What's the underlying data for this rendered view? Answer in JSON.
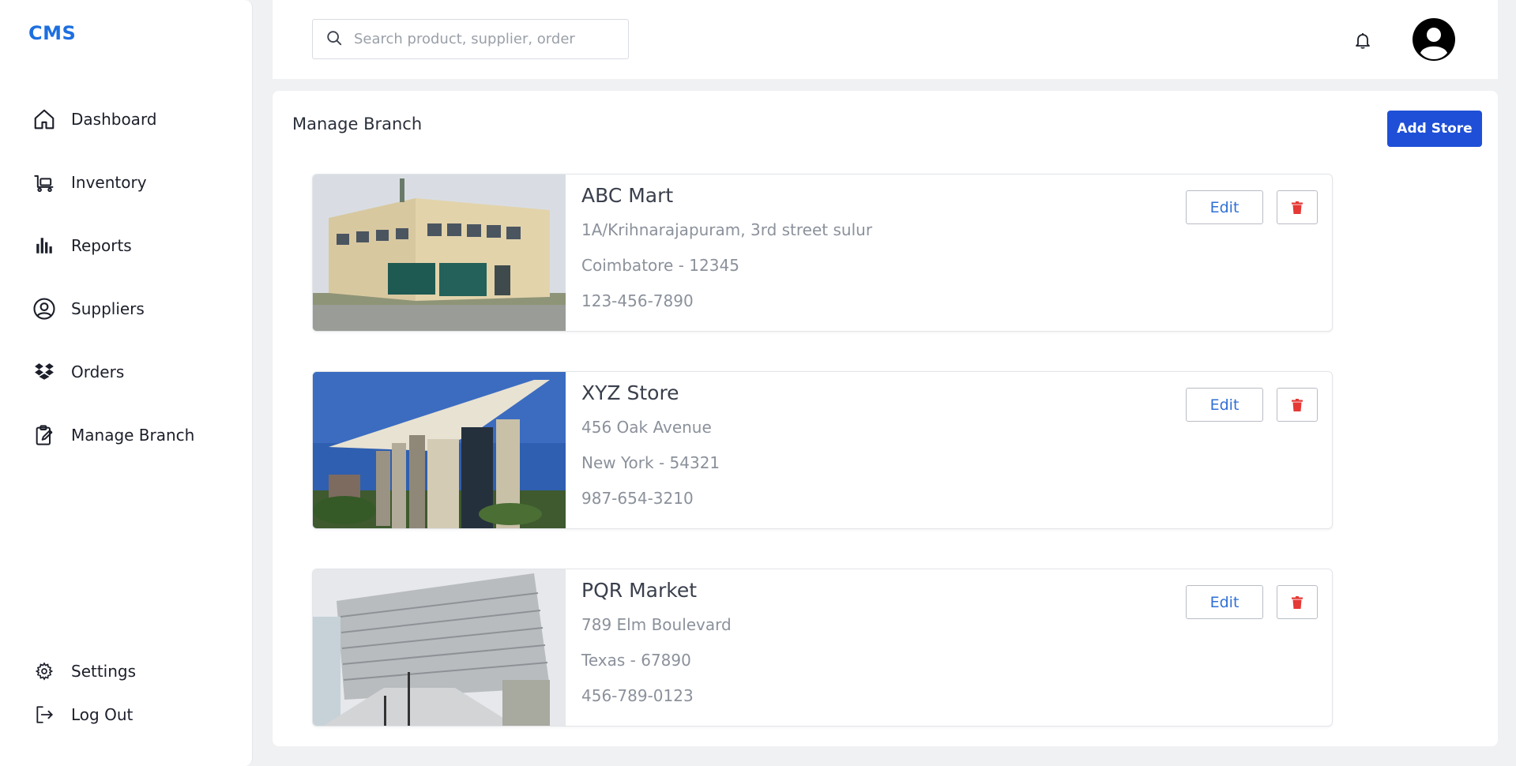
{
  "app": {
    "logo": "CMS"
  },
  "sidebar": {
    "items": [
      {
        "label": "Dashboard",
        "icon": "home-icon"
      },
      {
        "label": "Inventory",
        "icon": "inventory-icon"
      },
      {
        "label": "Reports",
        "icon": "bar-chart-icon"
      },
      {
        "label": "Suppliers",
        "icon": "user-circle-icon"
      },
      {
        "label": "Orders",
        "icon": "dropbox-icon"
      },
      {
        "label": "Manage Branch",
        "icon": "clipboard-edit-icon"
      }
    ],
    "bottom": [
      {
        "label": "Settings",
        "icon": "gear-icon"
      },
      {
        "label": "Log Out",
        "icon": "logout-icon"
      }
    ]
  },
  "header": {
    "search_placeholder": "Search product, supplier, order"
  },
  "main": {
    "title": "Manage Branch",
    "add_button": "Add Store"
  },
  "stores": [
    {
      "name": "ABC Mart",
      "address": "1A/Krihnarajapuram, 3rd street sulur",
      "city": "Coimbatore - 12345",
      "phone": "123-456-7890",
      "edit_label": "Edit"
    },
    {
      "name": "XYZ Store",
      "address": "456 Oak Avenue",
      "city": "New York - 54321",
      "phone": "987-654-3210",
      "edit_label": "Edit"
    },
    {
      "name": "PQR Market",
      "address": "789 Elm Boulevard",
      "city": "Texas - 67890",
      "phone": "456-789-0123",
      "edit_label": "Edit"
    }
  ],
  "colors": {
    "accent": "#1e4fd6",
    "logo": "#1d6fe0",
    "delete": "#e53935",
    "edit_text": "#2f6fd6"
  }
}
